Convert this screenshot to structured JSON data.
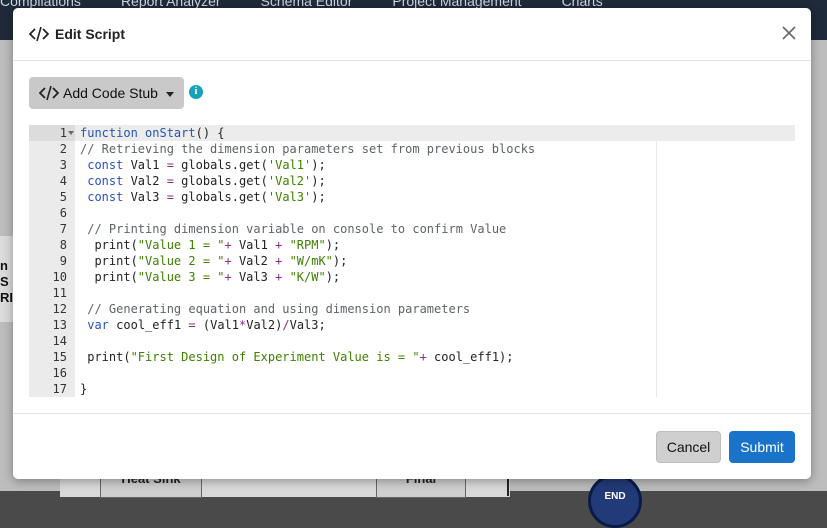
{
  "background": {
    "nav": [
      "Compilations",
      "Report Analyzer",
      "Schema Editor",
      "Project Management",
      "Charts"
    ],
    "side_text": "n S\nRI",
    "blocks": [
      "Heat Sink",
      "Final"
    ],
    "end_label": "END"
  },
  "modal": {
    "title": "Edit Script",
    "title_icon": "code-icon",
    "close_icon": "close-icon",
    "add_code_stub_label": "Add Code Stub",
    "info_icon_glyph": "i",
    "cancel_label": "Cancel",
    "submit_label": "Submit"
  },
  "editor": {
    "active_line": 1,
    "lines": [
      {
        "n": "1",
        "text": "function onStart() {"
      },
      {
        "n": "2",
        "text": "// Retrieving the dimension parameters set from previous blocks"
      },
      {
        "n": "3",
        "text": " const Val1 = globals.get('Val1');"
      },
      {
        "n": "4",
        "text": " const Val2 = globals.get('Val2');"
      },
      {
        "n": "5",
        "text": " const Val3 = globals.get('Val3');"
      },
      {
        "n": "6",
        "text": ""
      },
      {
        "n": "7",
        "text": " // Printing dimension variable on console to confirm Value"
      },
      {
        "n": "8",
        "text": "  print(\"Value 1 = \"+ Val1 + \"RPM\");"
      },
      {
        "n": "9",
        "text": "  print(\"Value 2 = \"+ Val2 + \"W/mK\");"
      },
      {
        "n": "10",
        "text": "  print(\"Value 3 = \"+ Val3 + \"K/W\");"
      },
      {
        "n": "11",
        "text": ""
      },
      {
        "n": "12",
        "text": " // Generating equation and using dimension parameters"
      },
      {
        "n": "13",
        "text": " var cool_eff1 = (Val1*Val2)/Val3;"
      },
      {
        "n": "14",
        "text": ""
      },
      {
        "n": "15",
        "text": " print(\"First Design of Experiment Value is = \"+ cool_eff1);"
      },
      {
        "n": "16",
        "text": ""
      },
      {
        "n": "17",
        "text": "}"
      }
    ]
  },
  "colors": {
    "primary": "#1a73c8",
    "info": "#17a2b8",
    "keyword": "#2455b8",
    "string": "#3f7f00",
    "comment": "#5f6466"
  }
}
